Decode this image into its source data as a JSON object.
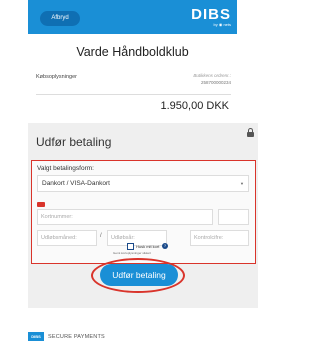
{
  "header": {
    "cancel_label": "Afbryd",
    "logo_text": "DIBS",
    "logo_sub": "by ◉ nets",
    "brand_color": "#1a8fd6"
  },
  "order": {
    "shop_name": "Varde Håndboldklub",
    "receipt_label": "Købsoplysninger",
    "order_number_label": "Butikkens ordrenr.:",
    "order_number": "258700000234",
    "amount": "1.950,00 DKK"
  },
  "payment": {
    "title": "Udfør betaling",
    "method_label": "Valgt betalingsform:",
    "method_value": "Dankort / VISA-Dankort",
    "card_number_placeholder": "Kortnummer:",
    "expiry_month_placeholder": "Udløbsmåned:",
    "expiry_separator": "/",
    "expiry_year_placeholder": "Udløbsår:",
    "cvc_placeholder": "Kontrolcifre:",
    "save_card_label": "Husk mit kort",
    "save_card_note": "Gemt kortoplysninger sikkert",
    "submit_label": "Udfør betaling",
    "highlight_color": "#d9342b"
  },
  "footer": {
    "logo_text": "DIBS",
    "text": "SECURE PAYMENTS"
  }
}
